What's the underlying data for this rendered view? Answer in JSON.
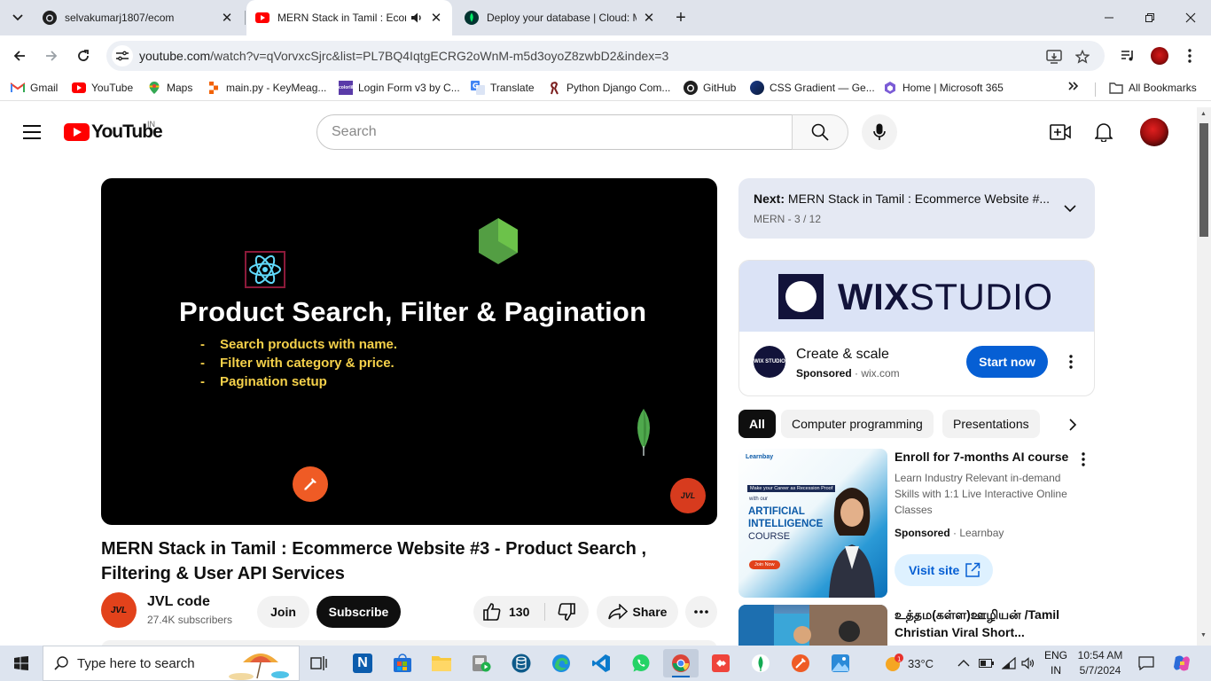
{
  "browser": {
    "tabs": [
      {
        "title": "selvakumarj1807/ecom",
        "icon": "github-icon",
        "active": false
      },
      {
        "title": "MERN Stack in Tamil : Ecom",
        "icon": "youtube-icon",
        "active": true
      },
      {
        "title": "Deploy your database | Cloud: M",
        "icon": "mongodb-leaf-icon",
        "active": false
      }
    ],
    "url_domain": "youtube.com",
    "url_path": "/watch?v=qVorvxcSjrc&list=PL7BQ4IqtgECRG2oWnM-m5d3oyoZ8zwbD2&index=3",
    "bookmarks": [
      {
        "label": "Gmail",
        "icon": "gmail-icon"
      },
      {
        "label": "YouTube",
        "icon": "youtube-icon"
      },
      {
        "label": "Maps",
        "icon": "maps-icon"
      },
      {
        "label": "main.py - KeyMeag...",
        "icon": "replit-icon"
      },
      {
        "label": "Login Form v3 by C...",
        "icon": "colorlib-icon"
      },
      {
        "label": "Translate",
        "icon": "translate-icon"
      },
      {
        "label": "Python Django Com...",
        "icon": "django-icon"
      },
      {
        "label": "GitHub",
        "icon": "github-icon"
      },
      {
        "label": "CSS Gradient — Ge...",
        "icon": "css-gradient-icon"
      },
      {
        "label": "Home | Microsoft 365",
        "icon": "m365-icon"
      }
    ],
    "all_bookmarks": "All Bookmarks"
  },
  "youtube": {
    "logo_text": "YouTube",
    "country": "IN",
    "search_placeholder": "Search",
    "thumbnail": {
      "headline": "Product Search, Filter & Pagination",
      "bullets": [
        "Search products with name.",
        "Filter with category & price.",
        "Pagination setup"
      ],
      "bullet_mark": "-",
      "watermark": "JVL"
    },
    "video_title": "MERN Stack in Tamil : Ecommerce Website #3 - Product Search , Filtering & User API Services",
    "channel": {
      "name": "JVL code",
      "subscribers": "27.4K subscribers",
      "avatar_text": "JVL"
    },
    "actions": {
      "join": "Join",
      "subscribe": "Subscribe",
      "likes": "130",
      "share": "Share"
    },
    "playlist": {
      "next_label": "Next:",
      "next_title": "MERN Stack in Tamil : Ecommerce Website  #...",
      "position": "MERN - 3 / 12"
    },
    "ad1": {
      "brand_bold": "WIX",
      "brand_light": "STUDIO",
      "logo_text": "WIX STUDIO",
      "title": "Create & scale",
      "sponsored": "Sponsored",
      "domain": "wix.com",
      "cta": "Start now"
    },
    "chips": [
      "All",
      "Computer programming",
      "Presentations"
    ],
    "ad2": {
      "thumb_brand": "Learnbay",
      "thumb_badge": "Make your Career as Recession Proof",
      "thumb_with": "with our",
      "thumb_ai": "ARTIFICIAL INTELLIGENCE",
      "thumb_course": "COURSE",
      "thumb_join": "Join Now",
      "title": "Enroll for 7-months AI course",
      "description": "Learn Industry Relevant in-demand Skills with 1:1 Live Interactive Online Classes",
      "sponsored": "Sponsored",
      "advertiser": "Learnbay",
      "cta": "Visit site"
    },
    "rec1": {
      "title": "உத்தம(கள்ள)ஊழியன் /Tamil Christian Viral Short..."
    }
  },
  "taskbar": {
    "search_placeholder": "Type here to search",
    "weather": "33°C",
    "lang_line1": "ENG",
    "lang_line2": "IN",
    "time": "10:54 AM",
    "date": "5/7/2024"
  }
}
